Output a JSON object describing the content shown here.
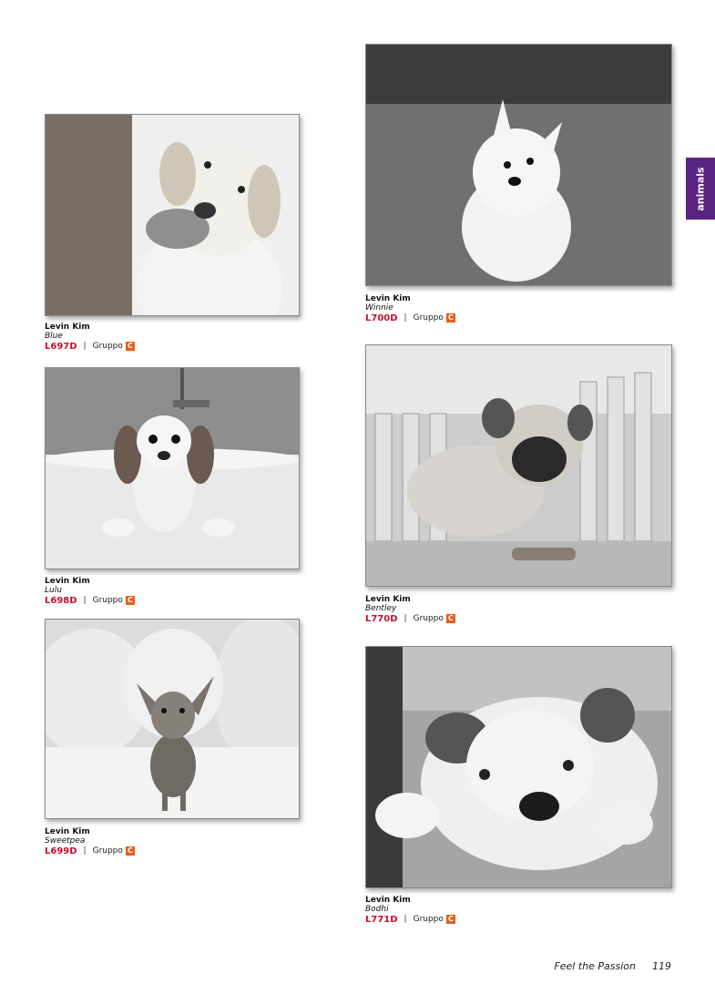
{
  "side_tab": {
    "label": "animals",
    "color": "#5a2283"
  },
  "items": [
    {
      "artist": "Levin Kim",
      "title": "Blue",
      "code": "L697D",
      "gruppo": "Gruppo",
      "badge": "C"
    },
    {
      "artist": "Levin Kim",
      "title": "Lulu",
      "code": "L698D",
      "gruppo": "Gruppo",
      "badge": "C"
    },
    {
      "artist": "Levin Kim",
      "title": "Sweetpea",
      "code": "L699D",
      "gruppo": "Gruppo",
      "badge": "C"
    },
    {
      "artist": "Levin Kim",
      "title": "Winnie",
      "code": "L700D",
      "gruppo": "Gruppo",
      "badge": "C"
    },
    {
      "artist": "Levin Kim",
      "title": "Bentley",
      "code": "L770D",
      "gruppo": "Gruppo",
      "badge": "C"
    },
    {
      "artist": "Levin Kim",
      "title": "Bodhi",
      "code": "L771D",
      "gruppo": "Gruppo",
      "badge": "C"
    }
  ],
  "footer": {
    "tagline": "Feel the Passion",
    "page_number": "119"
  },
  "colors": {
    "code": "#c8102e",
    "badge": "#e85d1a"
  }
}
